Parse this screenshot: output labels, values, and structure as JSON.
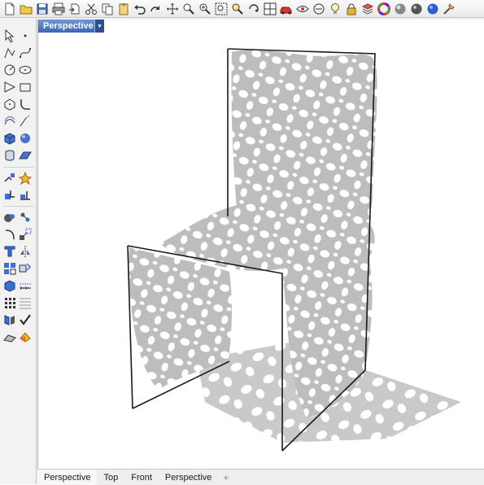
{
  "viewport": {
    "active_tab_label": "Perspective",
    "dropdown_glyph": "▾"
  },
  "bottom_tabs": [
    "Perspective",
    "Top",
    "Front",
    "Perspective"
  ],
  "bottom_tabs_add_glyph": "+",
  "colors": {
    "accent_tab": "#3b66b5",
    "model_fill": "#bdbdbd",
    "shadow": "#b7b7b7",
    "frame_line": "#1a1a1a"
  },
  "top_toolbar_icons": [
    "new-file-icon",
    "open-folder-icon",
    "save-icon",
    "print-icon",
    "import-icon",
    "cut-icon",
    "copy-icon",
    "paste-icon",
    "undo-icon",
    "redo-icon",
    "pan-icon",
    "zoom-window-icon",
    "zoom-extents-icon",
    "zoom-selected-icon",
    "zoom-icon",
    "rotate-view-icon",
    "four-views-icon",
    "car-icon",
    "eye-icon",
    "select-icon",
    "light-bulb-icon",
    "lock-icon",
    "layer-icon",
    "color-wheel-icon",
    "sphere-render-icon",
    "shaded-sphere-icon",
    "globe-icon",
    "settings-icon"
  ],
  "left_toolbar_icons": [
    "select-arrow-icon",
    "point-icon",
    "polyline-icon",
    "curve-icon",
    "circle-icon",
    "ellipse-icon",
    "arc-icon",
    "rectangle-icon",
    "polygon-icon",
    "fillet-curve-icon",
    "offset-curve-icon",
    "extend-icon",
    "box-solid-icon",
    "sphere-solid-icon",
    "cylinder-icon",
    "surface-icon",
    "split-icon",
    "explode-icon",
    "boolean-icon",
    "trim-icon",
    "boolean-union-icon",
    "move-icon",
    "rotate-icon",
    "scale-icon",
    "text-icon",
    "mirror-icon",
    "array-icon",
    "group-icon",
    "box-select-icon",
    "measure-icon",
    "dimension-icon",
    "grid-icon",
    "check-icon",
    "analyze-icon",
    "render-icon",
    "material-icon"
  ]
}
